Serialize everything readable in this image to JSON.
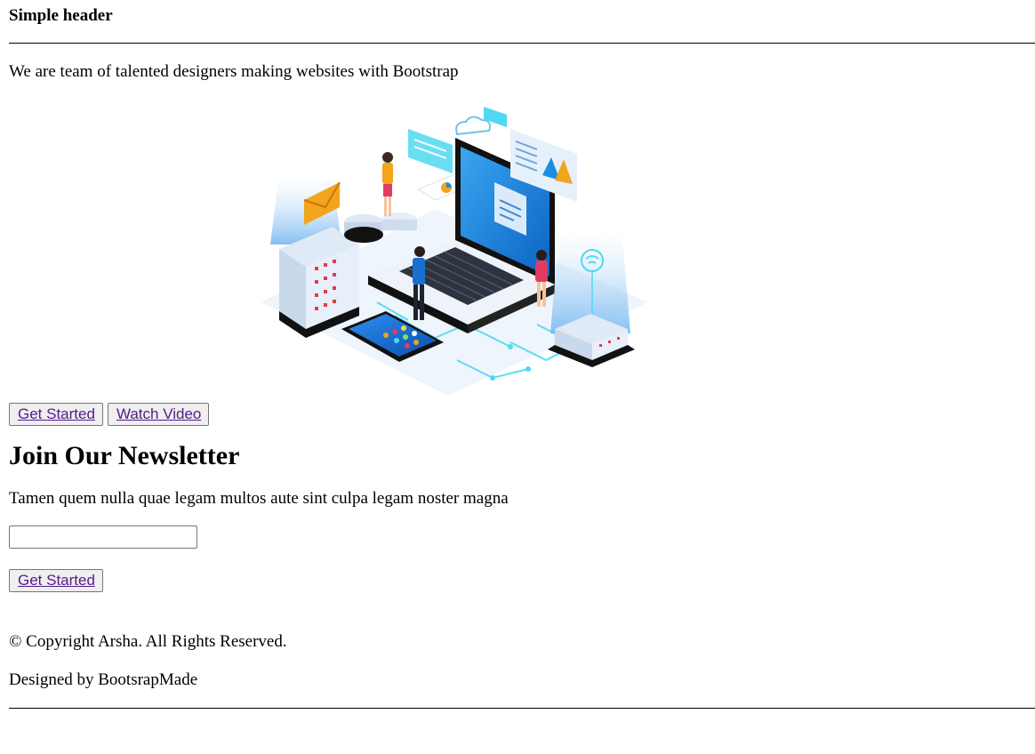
{
  "header": {
    "title": "Simple header"
  },
  "hero": {
    "tagline": "We are team of talented designers making websites with Bootstrap",
    "illustration_icon": "laptop-datacenter-illustration",
    "buttons": {
      "get_started": "Get Started",
      "watch_video": "Watch Video"
    }
  },
  "newsletter": {
    "title": "Join Our Newsletter",
    "description": "Tamen quem nulla quae legam multos aute sint culpa legam noster magna",
    "email_value": "",
    "button": "Get Started"
  },
  "footer": {
    "copyright": "© Copyright Arsha. All Rights Reserved.",
    "designed_by": "Designed by BootsrapMade"
  },
  "colors": {
    "link": "#551a8b",
    "button_bg": "#efefef",
    "button_border": "#767676",
    "illustration_blue": "#1a8fe0",
    "illustration_cyan": "#4fd8f0"
  }
}
